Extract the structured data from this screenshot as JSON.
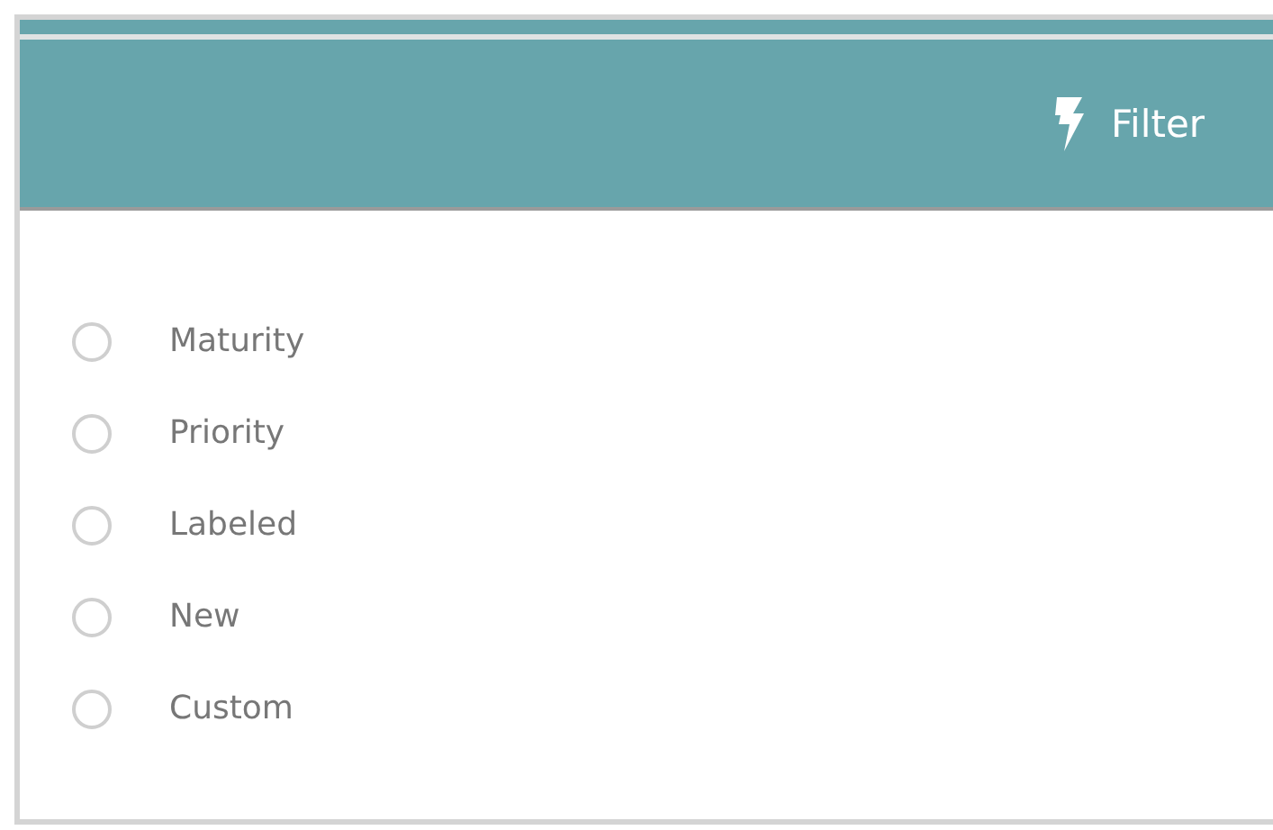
{
  "header": {
    "action": {
      "label": "Filter"
    }
  },
  "options": [
    {
      "label": "Maturity",
      "selected": false
    },
    {
      "label": "Priority",
      "selected": false
    },
    {
      "label": "Labeled",
      "selected": false
    },
    {
      "label": "New",
      "selected": false
    },
    {
      "label": "Custom",
      "selected": false
    }
  ]
}
